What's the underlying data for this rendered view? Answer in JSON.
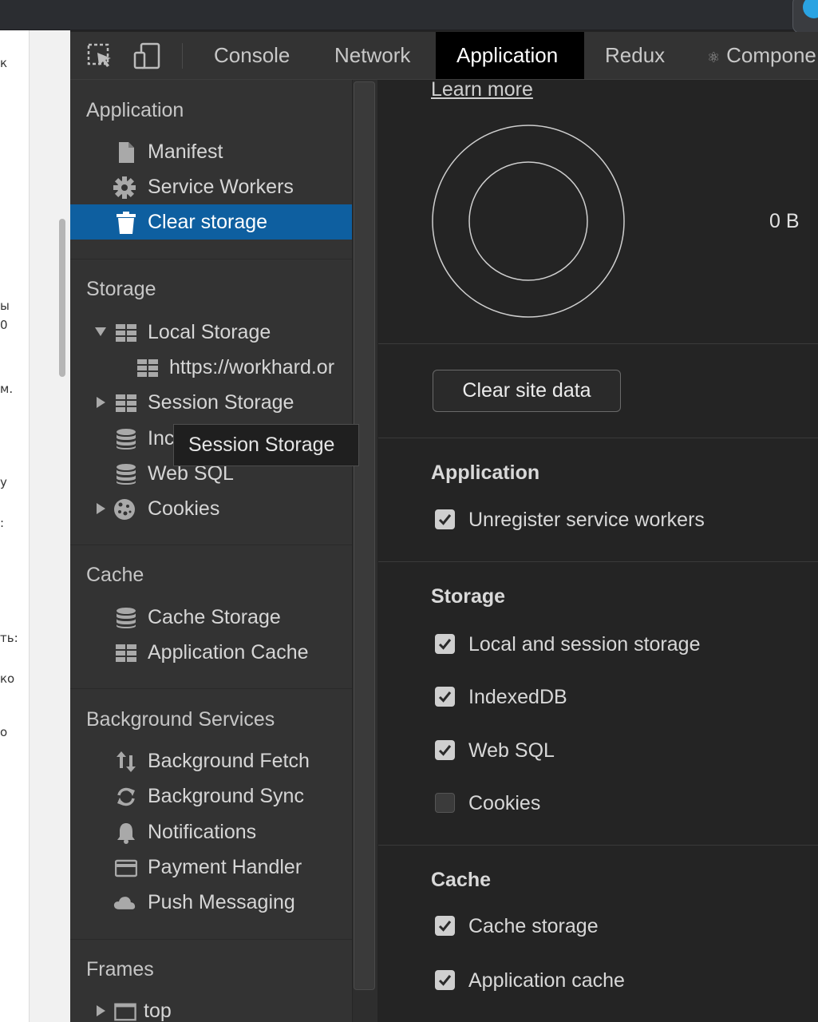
{
  "toolbar": {
    "tabs": [
      "Console",
      "Network",
      "Application",
      "Redux",
      "Compone"
    ],
    "active_tab": "Application",
    "components_tab_icon": "react-icon"
  },
  "sidebar": {
    "sections": {
      "application": "Application",
      "storage": "Storage",
      "cache": "Cache",
      "background_services": "Background Services",
      "frames": "Frames"
    },
    "application_items": [
      {
        "label": "Manifest",
        "icon": "document-icon"
      },
      {
        "label": "Service Workers",
        "icon": "gear-icon"
      },
      {
        "label": "Clear storage",
        "icon": "trash-icon",
        "selected": true
      }
    ],
    "storage_items": [
      {
        "label": "Local Storage",
        "icon": "grid-icon",
        "expanded": true
      },
      {
        "label": "https://workhard.or",
        "icon": "grid-icon"
      },
      {
        "label": "Session Storage",
        "icon": "grid-icon",
        "expanded": false
      },
      {
        "label": "Inc",
        "icon": "database-icon"
      },
      {
        "label": "Web SQL",
        "icon": "database-icon"
      },
      {
        "label": "Cookies",
        "icon": "cookie-icon",
        "expanded": false
      }
    ],
    "cache_items": [
      {
        "label": "Cache Storage",
        "icon": "database-icon"
      },
      {
        "label": "Application Cache",
        "icon": "grid-icon"
      }
    ],
    "background_items": [
      {
        "label": "Background Fetch",
        "icon": "arrows-updown-icon"
      },
      {
        "label": "Background Sync",
        "icon": "sync-icon"
      },
      {
        "label": "Notifications",
        "icon": "bell-icon"
      },
      {
        "label": "Payment Handler",
        "icon": "card-icon"
      },
      {
        "label": "Push Messaging",
        "icon": "cloud-icon"
      }
    ],
    "frames_items": [
      {
        "label": "top",
        "icon": "frame-icon",
        "expanded": false
      }
    ],
    "tooltip": "Session Storage"
  },
  "main": {
    "learn_more": "Learn more",
    "usage_value": "0 B",
    "clear_button": "Clear site data",
    "groups": [
      {
        "title": "Application",
        "options": [
          {
            "label": "Unregister service workers",
            "checked": true
          }
        ]
      },
      {
        "title": "Storage",
        "options": [
          {
            "label": "Local and session storage",
            "checked": true
          },
          {
            "label": "IndexedDB",
            "checked": true
          },
          {
            "label": "Web SQL",
            "checked": true
          },
          {
            "label": "Cookies",
            "checked": false
          }
        ]
      },
      {
        "title": "Cache",
        "options": [
          {
            "label": "Cache storage",
            "checked": true
          },
          {
            "label": "Application cache",
            "checked": true
          }
        ]
      }
    ]
  },
  "page_fragments": [
    "к",
    "ы",
    "0",
    "м.",
    "у",
    ":",
    "ть:",
    "ко",
    "о"
  ],
  "colors": {
    "selected_bg": "#0e5fa0",
    "active_tab_bg": "#000000",
    "panel_bg": "#242424",
    "sidebar_bg": "#333333"
  }
}
